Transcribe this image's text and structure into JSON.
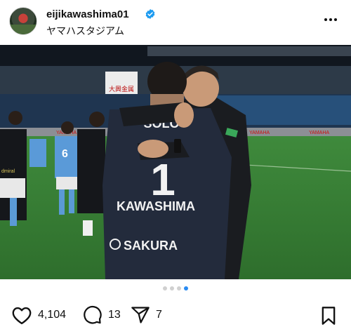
{
  "post": {
    "username": "eijikawashima01",
    "location": "ヤマハスタジアム"
  },
  "photo": {
    "jersey_name_back": "SOLO",
    "jersey_number": "1",
    "jersey_name": "KAWASHIMA",
    "sponsor": "SAKURA",
    "stadium_sign": "大興金属",
    "ad_board": "YAMAHA",
    "away_number": "6",
    "bench_label": "dmiral"
  },
  "carousel": {
    "total": 4,
    "active": 4
  },
  "engagement": {
    "likes": "4,104",
    "comments": "13",
    "shares": "7"
  },
  "colors": {
    "accent": "#2a8bf2",
    "verified": "#1d9bf0"
  }
}
